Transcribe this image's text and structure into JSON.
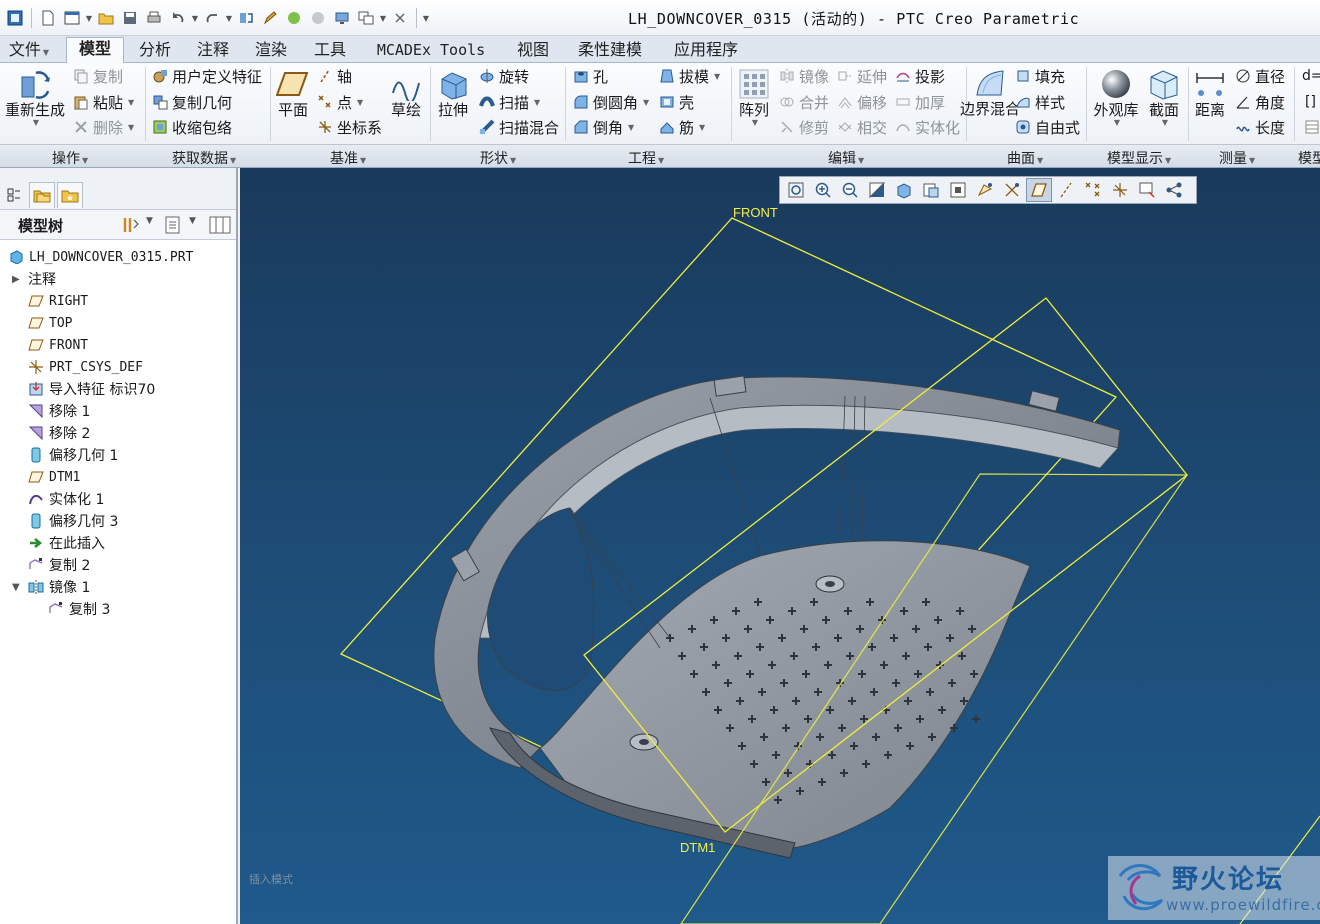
{
  "window": {
    "title": "LH_DOWNCOVER_0315 (活动的) - PTC Creo Parametric"
  },
  "menu_tabs": [
    "文件",
    "模型",
    "分析",
    "注释",
    "渲染",
    "工具",
    "MCADEx Tools",
    "视图",
    "柔性建模",
    "应用程序"
  ],
  "active_tab": "模型",
  "ribbon": {
    "regenerate": "重新生成",
    "copy": "复制",
    "paste": "粘贴",
    "delete": "删除",
    "udf": "用户定义特征",
    "copy_geom": "复制几何",
    "shrinkwrap": "收缩包络",
    "plane": "平面",
    "axis": "轴",
    "point": "点",
    "csys": "坐标系",
    "sketch": "草绘",
    "extrude": "拉伸",
    "revolve": "旋转",
    "sweep": "扫描",
    "swept_blend": "扫描混合",
    "hole": "孔",
    "round": "倒圆角",
    "chamfer": "倒角",
    "draft": "拔模",
    "shell": "壳",
    "rib": "筋",
    "pattern": "阵列",
    "mirror": "镜像",
    "merge": "合并",
    "trim": "修剪",
    "extend": "延伸",
    "offset": "偏移",
    "intersect": "相交",
    "project": "投影",
    "thicken": "加厚",
    "solidify": "实体化",
    "boundary_blend": "边界混合",
    "fill": "填充",
    "style": "样式",
    "freestyle": "自由式",
    "appearance": "外观库",
    "section": "截面",
    "distance": "距离",
    "diameter": "直径",
    "angle": "角度",
    "length": "长度"
  },
  "groups": [
    "操作",
    "获取数据",
    "基准",
    "形状",
    "工程",
    "编辑",
    "曲面",
    "模型显示",
    "测量",
    "模型"
  ],
  "model_tree": {
    "title": "模型树",
    "items": [
      {
        "label": "LH_DOWNCOVER_0315.PRT",
        "icon": "part-icon"
      },
      {
        "label": "注释",
        "icon": "none"
      },
      {
        "label": "RIGHT",
        "icon": "datum-plane-icon"
      },
      {
        "label": "TOP",
        "icon": "datum-plane-icon"
      },
      {
        "label": "FRONT",
        "icon": "datum-plane-icon"
      },
      {
        "label": "PRT_CSYS_DEF",
        "icon": "csys-icon"
      },
      {
        "label": "导入特征 标识70",
        "icon": "import-icon"
      },
      {
        "label": "移除 1",
        "icon": "remove-icon"
      },
      {
        "label": "移除 2",
        "icon": "remove-icon"
      },
      {
        "label": "偏移几何 1",
        "icon": "offset-geom-icon"
      },
      {
        "label": "DTM1",
        "icon": "datum-plane-icon"
      },
      {
        "label": "实体化 1",
        "icon": "solidify-icon"
      },
      {
        "label": "偏移几何 3",
        "icon": "offset-geom-icon"
      },
      {
        "label": "在此插入",
        "icon": "insert-arrow-icon"
      },
      {
        "label": "复制 2",
        "icon": "copy-feature-icon"
      },
      {
        "label": "镜像 1",
        "icon": "mirror-icon"
      },
      {
        "label": "复制 3",
        "icon": "copy-feature-icon"
      }
    ]
  },
  "viewport": {
    "datum_labels": [
      "FRONT",
      "DTM1"
    ],
    "status": "插入模式",
    "datum_color": "#f4f04a",
    "background_color": "#1d4a73"
  },
  "watermark": {
    "text": "野火论坛",
    "url": "www.proewildfire.cn"
  },
  "colors": {
    "ribbon_bg": "#eef2f7",
    "tab_bar": "#dfe6ef",
    "model_gray": "#8c939c"
  }
}
